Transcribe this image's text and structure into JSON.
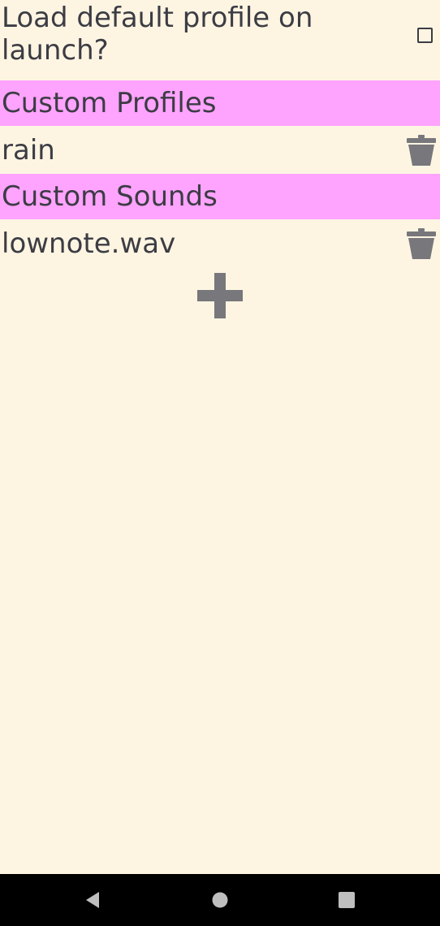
{
  "settings": {
    "load_default_label": "Load default profile on launch?",
    "load_default_checked": false
  },
  "profiles": {
    "header": "Custom Profiles",
    "items": [
      {
        "label": "rain"
      }
    ]
  },
  "sounds": {
    "header": "Custom Sounds",
    "items": [
      {
        "label": "lownote.wav"
      }
    ]
  },
  "icons": {
    "delete": "trash-icon",
    "add": "plus-icon",
    "back": "back-triangle-icon",
    "home": "home-circle-icon",
    "recents": "recents-square-icon"
  },
  "colors": {
    "background": "#fdf5e2",
    "section_header": "#fea3fe",
    "text": "#3c3c44",
    "icon": "#77777c",
    "navbar": "#000000",
    "nav_icon": "#bfbfbf"
  }
}
